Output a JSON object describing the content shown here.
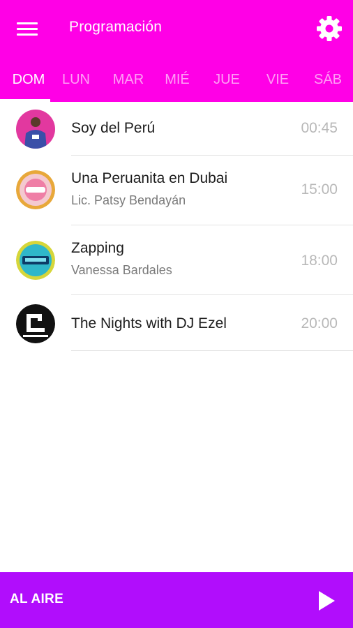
{
  "header": {
    "title": "Programación",
    "menu_icon": "hamburger-menu-icon",
    "settings_icon": "gear-icon",
    "color": "#ff00e6"
  },
  "tabs": [
    {
      "label": "DOM",
      "active": true
    },
    {
      "label": "LUN",
      "active": false
    },
    {
      "label": "MAR",
      "active": false
    },
    {
      "label": "MIÉ",
      "active": false
    },
    {
      "label": "JUE",
      "active": false
    },
    {
      "label": "VIE",
      "active": false
    },
    {
      "label": "SÁB",
      "active": false
    }
  ],
  "programs": [
    {
      "name": "Soy del Perú",
      "host": "",
      "time": "00:45"
    },
    {
      "name": "Una Peruanita en Dubai",
      "host": "Lic. Patsy Bendayán",
      "time": "15:00"
    },
    {
      "name": "Zapping",
      "host": "Vanessa Bardales",
      "time": "18:00"
    },
    {
      "name": "The Nights with DJ Ezel",
      "host": "",
      "time": "20:00"
    }
  ],
  "footer": {
    "label": "AL AIRE",
    "play_icon": "play-icon",
    "color": "#b10dfc"
  }
}
